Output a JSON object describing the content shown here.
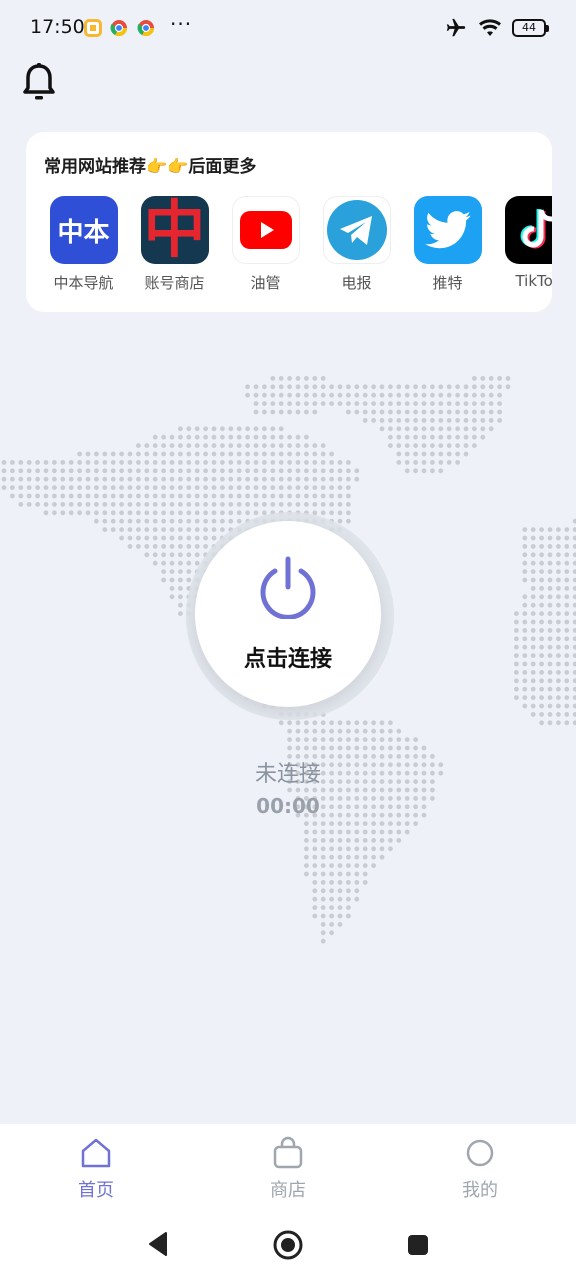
{
  "status_bar": {
    "time": "17:50",
    "more": "···",
    "battery": "44"
  },
  "recommended": {
    "title": "常用网站推荐👉👉后面更多",
    "items": [
      {
        "label": "中本导航",
        "icon": "zhongben-logo",
        "icon_text": "中本",
        "color": "#2f4fd6"
      },
      {
        "label": "账号商店",
        "icon": "account-store-logo",
        "icon_text": "中",
        "color": "#e5262f"
      },
      {
        "label": "油管",
        "icon": "youtube-logo",
        "color": "#ff0000"
      },
      {
        "label": "电报",
        "icon": "telegram-logo",
        "color": "#2aa1da"
      },
      {
        "label": "推特",
        "icon": "twitter-logo",
        "color": "#1da1f2"
      },
      {
        "label": "TikTok",
        "icon": "tiktok-logo",
        "color": "#000000"
      }
    ]
  },
  "connect": {
    "button_label": "点击连接",
    "status": "未连接",
    "timer": "00:00",
    "accent": "#6f72d4"
  },
  "bottom_nav": {
    "items": [
      {
        "label": "首页",
        "icon": "home-icon",
        "active": true
      },
      {
        "label": "商店",
        "icon": "shopping-bag-icon",
        "active": false
      },
      {
        "label": "我的",
        "icon": "profile-circle-icon",
        "active": false
      }
    ]
  }
}
